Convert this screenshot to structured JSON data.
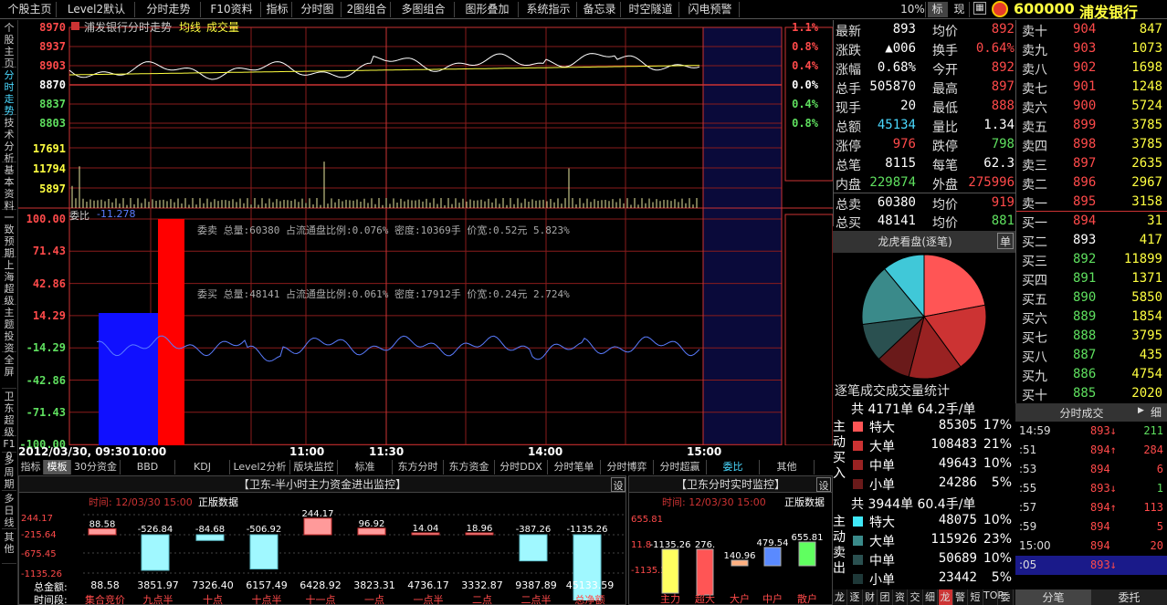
{
  "menu": [
    "个股主页",
    "Level2默认",
    "分时走势",
    "F10资料",
    "指标",
    "分时图",
    "2图组合",
    "多图组合",
    "图形叠加",
    "系统指示",
    "备忘录",
    "时空隧道",
    "闪电预警"
  ],
  "menu_right": {
    "zoom": "10%",
    "b1": "标",
    "b2": "现"
  },
  "stock": {
    "code": "600000",
    "name": "浦发银行"
  },
  "left_tabs": [
    "个股主页",
    "分时走势",
    "技术分析",
    "基本资料",
    "一致预期",
    "上海超级",
    "主题投资",
    "全屏",
    "卫东超级",
    "F10",
    "多周期",
    "多日线",
    "其他"
  ],
  "chart": {
    "legend_name": "浦发银行分时走势",
    "legend_avg": "均线",
    "legend_vol": "成交量",
    "price_left": [
      "8970",
      "8937",
      "8903",
      "8870",
      "8837",
      "8803"
    ],
    "price_right": [
      "1.1%",
      "0.8%",
      "0.4%",
      "0.0%",
      "0.4%",
      "0.8%"
    ],
    "vol_left": [
      "17691",
      "11794",
      "5897"
    ],
    "wb_title": "委比",
    "wb_value": "-11.278",
    "wb_left": [
      "100.00",
      "71.43",
      "42.86",
      "14.29",
      "-14.29",
      "-42.86",
      "-71.43",
      "-100.00"
    ],
    "sell_info": "委卖 总量:60380 占流通盘比例:0.076% 密度:10369手 价宽:0.52元 5.823%",
    "buy_info": "委买 总量:48141 占流通盘比例:0.061% 密度:17912手 价宽:0.24元 2.724%",
    "time_labels": [
      "2012/03/30, 09:30",
      "10:00",
      "11:00",
      "11:30",
      "14:00",
      "15:00"
    ]
  },
  "bottom_tabs": [
    "指标",
    "模板",
    "30分资金",
    "BBD",
    "KDJ",
    "Level2分析",
    "版块监控",
    "标准",
    "东方分时",
    "东方资金",
    "分时DDX",
    "分时笔单",
    "分时博弈",
    "分时超赢",
    "委比",
    "其他"
  ],
  "panel1": {
    "title": "【卫东-半小时主力资金进出监控】",
    "set": "设",
    "time": "时间: 12/03/30 15:00",
    "edition": "正版数据",
    "yticks": [
      "244.17",
      "-215.64",
      "-675.45",
      "-1135.26"
    ],
    "vals": [
      "88.58",
      "-526.84",
      "-84.68",
      "-506.92",
      "244.17",
      "96.92",
      "14.04",
      "18.96",
      "-387.26",
      "-1135.26"
    ],
    "total_label": "总金额:",
    "totals": [
      "88.58",
      "3851.97",
      "7326.40",
      "6157.49",
      "6428.92",
      "3823.31",
      "4736.17",
      "3332.87",
      "9387.89",
      "45133.59"
    ],
    "period_label": "时间段:",
    "periods": [
      "集合竞价",
      "九点半",
      "十点",
      "十点半",
      "十一点",
      "一点",
      "一点半",
      "二点",
      "二点半",
      "总净额"
    ]
  },
  "panel2": {
    "title": "【卫东分时实时监控】",
    "set": "设",
    "time": "时间: 12/03/30 15:00",
    "edition": "正版数据",
    "yticks": [
      "655.81",
      "11.8",
      "-1135.26"
    ],
    "vals": [
      "-1135.26",
      "276.",
      "140.96",
      "479.54",
      "655.81"
    ],
    "labels": [
      "主力",
      "超大",
      "大户",
      "中户",
      "散户"
    ]
  },
  "quote": [
    [
      "最新",
      "893",
      "均价",
      "892"
    ],
    [
      "涨跌",
      "▲006",
      "换手",
      "0.64%"
    ],
    [
      "涨幅",
      "0.68%",
      "今开",
      "892"
    ],
    [
      "总手",
      "505870",
      "最高",
      "897"
    ],
    [
      "现手",
      "20",
      "最低",
      "888"
    ],
    [
      "总额",
      "45134",
      "量比",
      "1.34"
    ],
    [
      "涨停",
      "976",
      "跌停",
      "798"
    ],
    [
      "总笔",
      "8115",
      "每笔",
      "62.3"
    ],
    [
      "内盘",
      "229874",
      "外盘",
      "275996"
    ],
    [
      "总卖",
      "60380",
      "均价",
      "919"
    ],
    [
      "总买",
      "48141",
      "均价",
      "881"
    ]
  ],
  "dragon": {
    "title": "龙虎看盘(逐笔)",
    "btn": "单",
    "foot": "逐笔成交成交量统计",
    "pie": [
      22,
      18,
      14,
      9,
      10,
      16,
      11
    ]
  },
  "buy_stats": {
    "header": "共 4171单 64.2手/单",
    "side": "主动买入",
    "rows": [
      [
        "特大",
        "85305",
        "17%"
      ],
      [
        "大单",
        "108483",
        "21%"
      ],
      [
        "中单",
        "49643",
        "10%"
      ],
      [
        "小单",
        "24286",
        "5%"
      ]
    ]
  },
  "sell_stats": {
    "header": "共 3944单 60.4手/单",
    "side": "主动卖出",
    "rows": [
      [
        "特大",
        "48075",
        "10%"
      ],
      [
        "大单",
        "115926",
        "23%"
      ],
      [
        "中单",
        "50689",
        "10%"
      ],
      [
        "小单",
        "23442",
        "5%"
      ]
    ]
  },
  "bottom_icons": [
    "龙",
    "逐",
    "财",
    "团",
    "资",
    "交",
    "细",
    "龙",
    "警",
    "短",
    "TOP",
    "委"
  ],
  "book": {
    "sells": [
      [
        "卖十",
        "904",
        "847"
      ],
      [
        "卖九",
        "903",
        "1073"
      ],
      [
        "卖八",
        "902",
        "1698"
      ],
      [
        "卖七",
        "901",
        "1248"
      ],
      [
        "卖六",
        "900",
        "5724"
      ],
      [
        "卖五",
        "899",
        "3785"
      ],
      [
        "卖四",
        "898",
        "3785"
      ],
      [
        "卖三",
        "897",
        "2635"
      ],
      [
        "卖二",
        "896",
        "2967"
      ],
      [
        "卖一",
        "895",
        "3158"
      ]
    ],
    "buys": [
      [
        "买一",
        "894",
        "31"
      ],
      [
        "买二",
        "893",
        "417"
      ],
      [
        "买三",
        "892",
        "11899"
      ],
      [
        "买四",
        "891",
        "1371"
      ],
      [
        "买五",
        "890",
        "5850"
      ],
      [
        "买六",
        "889",
        "1854"
      ],
      [
        "买七",
        "888",
        "3795"
      ],
      [
        "买八",
        "887",
        "435"
      ],
      [
        "买九",
        "886",
        "4754"
      ],
      [
        "买十",
        "885",
        "2020"
      ]
    ]
  },
  "ticks": {
    "title": "分时成交",
    "mode": "细",
    "rows": [
      [
        "14:59",
        "893↓",
        "211"
      ],
      [
        ":51",
        "894↑",
        "284"
      ],
      [
        ":53",
        "894",
        "6"
      ],
      [
        ":55",
        "893↓",
        "1"
      ],
      [
        ":57",
        "894↑",
        "113"
      ],
      [
        ":59",
        "894",
        "5"
      ],
      [
        "15:00",
        "894",
        "20"
      ],
      [
        ":05",
        "893↓",
        ""
      ]
    ]
  },
  "tick_tabs": [
    "分笔",
    "委托"
  ],
  "colors": {
    "up": "#ff4a4a",
    "down": "#5fe05f",
    "grid": "#8a1c1c",
    "bg": "#000000"
  }
}
